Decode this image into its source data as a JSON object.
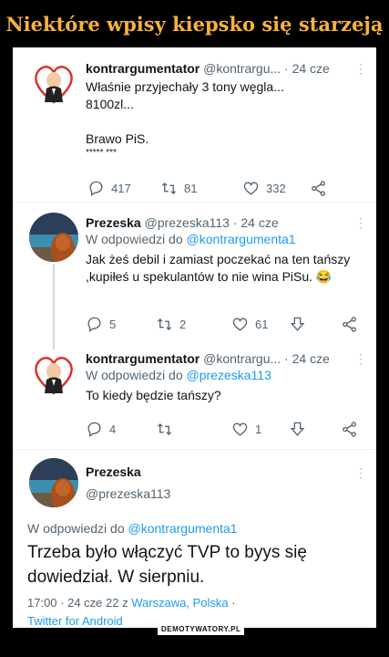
{
  "headline": "Niektóre wpisy kiepsko się starzeją",
  "tweets": [
    {
      "name": "kontrargumentator",
      "handle": "@kontrargu...",
      "time": "· 24 cze",
      "more": "⋮",
      "lines": [
        "Właśnie przyjechały 3 tony węgla...",
        "8100zl...",
        "",
        "Brawo PiS.",
        "***** ***"
      ],
      "replies": "417",
      "retweets": "81",
      "likes": "332"
    },
    {
      "name": "Prezeska",
      "handle": "@prezeska113",
      "time": "· 24 cze",
      "more": "⋮",
      "reply_prefix": "W odpowiedzi do",
      "reply_to": "@kontrargumenta1",
      "text": "Jak żeś debil i zamiast poczekać na ten tańszy ,kupiłeś u spekulantów to nie wina PiSu. 😂",
      "replies": "5",
      "retweets": "2",
      "likes": "61"
    },
    {
      "name": "kontrargumentator",
      "handle": "@kontrargu...",
      "time": "· 24 cze",
      "more": "⋮",
      "reply_prefix": "W odpowiedzi do",
      "reply_to": "@prezeska113",
      "text": "To kiedy będzie tańszy?",
      "replies": "4",
      "retweets": "",
      "likes": "1"
    }
  ],
  "main_tweet": {
    "name": "Prezeska",
    "handle": "@prezeska113",
    "more": "⋮",
    "reply_prefix": "W odpowiedzi do",
    "reply_to": "@kontrargumenta1",
    "text": "Trzeba było włączyć TVP to byys się dowiedział. W sierpniu.",
    "timestamp": "17:00 · 24 cze 22 z",
    "location": "Warszawa, Polska",
    "dot": "·",
    "client": "Twitter for Android"
  },
  "watermark": "DEMOTYWATORY.PL",
  "colors": {
    "headline": "#f6b23a",
    "link": "#1d9bf0",
    "muted": "#536471"
  },
  "icons": [
    "reply-icon",
    "retweet-icon",
    "like-icon",
    "share-icon",
    "download-icon",
    "more-icon"
  ]
}
